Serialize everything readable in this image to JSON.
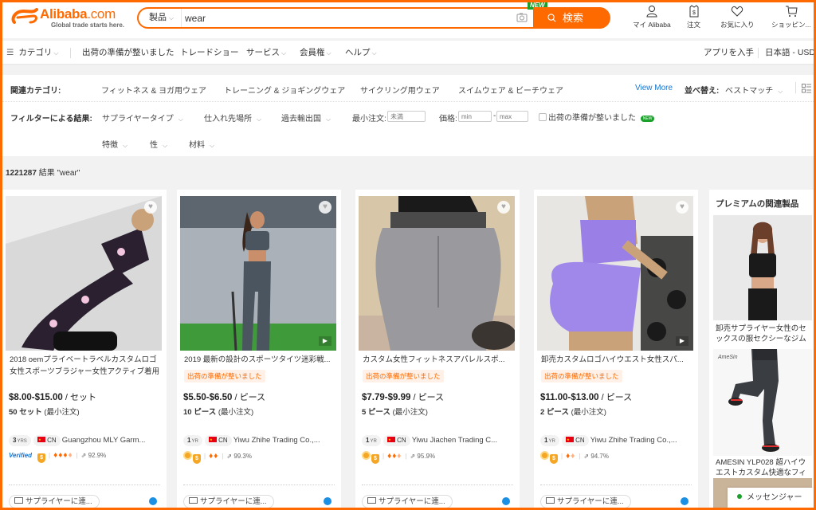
{
  "header": {
    "brand": "Alibaba",
    "brand_suffix": ".com",
    "tagline": "Global trade starts here.",
    "search": {
      "category": "製品",
      "query": "wear",
      "new_flag": "NEW",
      "button_label": "検索"
    },
    "actions": [
      {
        "icon": "user-icon",
        "label": "マイ Alibaba"
      },
      {
        "icon": "order-icon",
        "label": "注文"
      },
      {
        "icon": "heart-icon",
        "label": "お気に入り"
      },
      {
        "icon": "cart-icon",
        "label": "ショッピン..."
      }
    ]
  },
  "nav": {
    "categories": "カテゴリ",
    "items": [
      "出荷の準備が整いました",
      "トレードショー",
      "サービス",
      "会員権",
      "ヘルプ"
    ],
    "get_app": "アプリを入手",
    "language": "日本語 - USD"
  },
  "filters": {
    "related_label": "関連カテゴリ:",
    "related": [
      "フィットネス & ヨガ用ウェア",
      "トレーニング & ジョギングウェア",
      "サイクリング用ウェア",
      "スイムウェア & ビーチウェア"
    ],
    "view_more": "View More",
    "sort_label": "並べ替え:",
    "sort_value": "ベストマッチ",
    "filter_label": "フィルターによる結果:",
    "dropdowns": [
      "サプライヤータイプ",
      "仕入れ先場所",
      "過去輸出国"
    ],
    "moq_label": "最小注文:",
    "moq_placeholder": "未満",
    "price_label": "価格:",
    "price_min_placeholder": "min",
    "price_max_placeholder": "max",
    "ready_checkbox": "出荷の準備が整いました",
    "ready_new": "NEW",
    "dropdowns2": [
      "特徴",
      "性",
      "材料"
    ]
  },
  "results": {
    "count": "1221287",
    "text": "結果 \"wear\""
  },
  "products": [
    {
      "title": "2018 oemプライベートラベルカスタムロゴ女性スポーツブラジャー女性アクティブ着用",
      "ready": null,
      "price": "$8.00-$15.00",
      "unit": "/ セット",
      "moq_qty": "50 セット",
      "moq_label": "(最小注文)",
      "years": "3",
      "years_unit": "YRS",
      "country": "CN",
      "supplier": "Guangzhou MLY Garm...",
      "verified": "Verified",
      "diamonds": 3.5,
      "response_rate": "92.9%",
      "has_video": false,
      "contact": "サプライヤーに連..."
    },
    {
      "title": "2019 最新の設計のスポーツタイツ迷彩戦...",
      "ready": "出荷の準備が整いました",
      "price": "$5.50-$6.50",
      "unit": "/ ピース",
      "moq_qty": "10 ピース",
      "moq_label": "(最小注文)",
      "years": "1",
      "years_unit": "YR",
      "country": "CN",
      "supplier": "Yiwu Zhihe Trading Co.,...",
      "verified": null,
      "diamonds": 2,
      "response_rate": "99.3%",
      "has_video": true,
      "contact": "サプライヤーに連..."
    },
    {
      "title": "カスタム女性フィットネスアパレルスポ...",
      "ready": "出荷の準備が整いました",
      "price": "$7.79-$9.99",
      "unit": "/ ピース",
      "moq_qty": "5 ピース",
      "moq_label": "(最小注文)",
      "years": "1",
      "years_unit": "YR",
      "country": "CN",
      "supplier": "Yiwu Jiachen Trading C...",
      "verified": null,
      "diamonds": 2.5,
      "response_rate": "95.9%",
      "has_video": false,
      "contact": "サプライヤーに連..."
    },
    {
      "title": "卸売カスタムロゴハイウエスト女性スパ...",
      "ready": "出荷の準備が整いました",
      "price": "$11.00-$13.00",
      "unit": "/ ピース",
      "moq_qty": "2 ピース",
      "moq_label": "(最小注文)",
      "years": "1",
      "years_unit": "YR",
      "country": "CN",
      "supplier": "Yiwu Zhihe Trading Co.,...",
      "verified": null,
      "diamonds": 1.5,
      "response_rate": "94.7%",
      "has_video": true,
      "contact": "サプライヤーに連..."
    }
  ],
  "premium": {
    "heading": "プレミアムの関連製品",
    "items": [
      {
        "title": "卸売サプライヤー女性のセックスの服セクシーなジム"
      },
      {
        "title": "AMESIN YLP028 超ハイウエストカスタム快適なフィ",
        "brand_mark": "AmeSin"
      }
    ]
  },
  "messenger": "メッセンジャー",
  "colors": {
    "accent": "#ff6a00",
    "link": "#1a75d1",
    "new_badge": "#1aa02b"
  }
}
